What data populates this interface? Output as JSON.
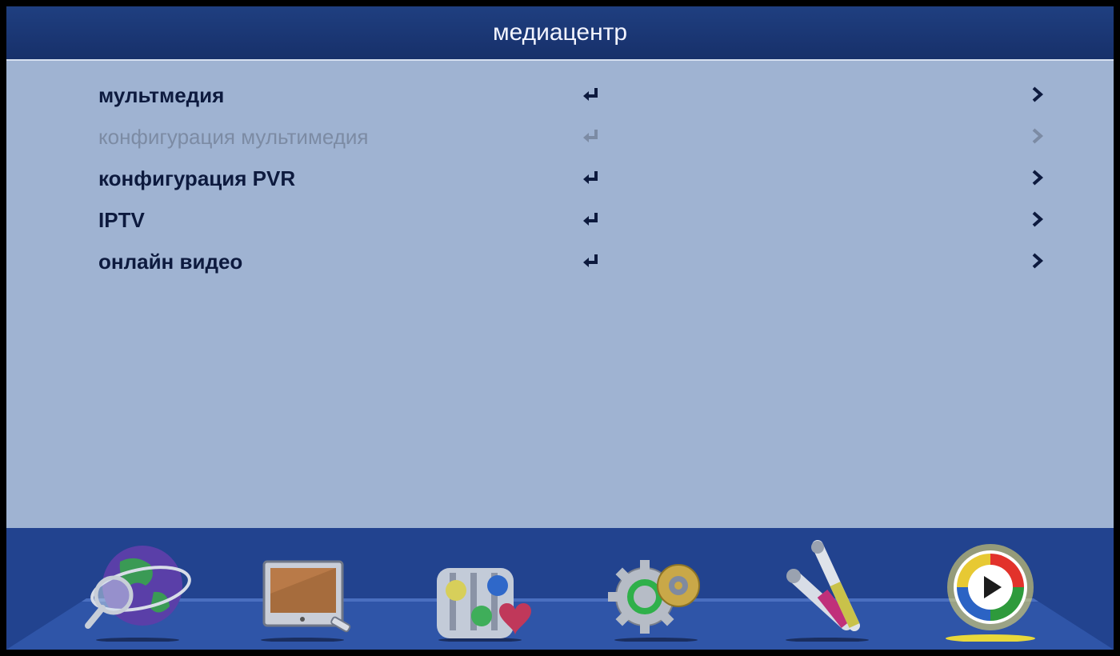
{
  "header": {
    "title": "медиацентр"
  },
  "menu": {
    "items": [
      {
        "label": "мультмедия",
        "enabled": true
      },
      {
        "label": "конфигурация мультимедия",
        "enabled": false
      },
      {
        "label": "конфигурация PVR",
        "enabled": true
      },
      {
        "label": "IPTV",
        "enabled": true
      },
      {
        "label": "онлайн видео",
        "enabled": true
      }
    ],
    "row_icons": [
      "enter-icon",
      "chevron-right-icon"
    ]
  },
  "dock": {
    "items": [
      {
        "icon": "globe-icon",
        "selected": false
      },
      {
        "icon": "tv-icon",
        "selected": false
      },
      {
        "icon": "equalizer-heart-icon",
        "selected": false
      },
      {
        "icon": "gears-icon",
        "selected": false
      },
      {
        "icon": "rca-cables-icon",
        "selected": false
      },
      {
        "icon": "media-play-icon",
        "selected": true
      }
    ]
  },
  "colors": {
    "title_bar": "#1f3f80",
    "panel": "#9fb3d2",
    "dock": "#22438f",
    "text_active": "#0d1a3e",
    "text_disabled": "#7c8ba4"
  }
}
